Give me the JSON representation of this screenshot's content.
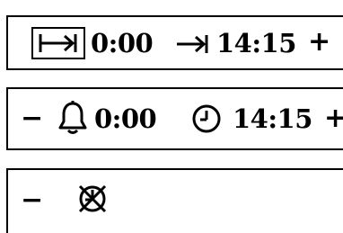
{
  "row_1": {
    "start_icon": "arrow-to-bar-boxed-icon",
    "start_time": "0:00",
    "end_icon": "arrow-to-bar-icon",
    "end_time": "14:15",
    "increment_label": "+"
  },
  "row_2": {
    "decrement_label": "−",
    "alarm_icon": "bell-icon",
    "alarm_time": "0:00",
    "clock_icon": "clock-icon",
    "clock_time": "14:15",
    "increment_label": "+"
  },
  "row_3": {
    "decrement_label": "−",
    "status_icon": "alarm-off-icon"
  },
  "colors": {
    "foreground": "#000000",
    "background": "#ffffff"
  }
}
